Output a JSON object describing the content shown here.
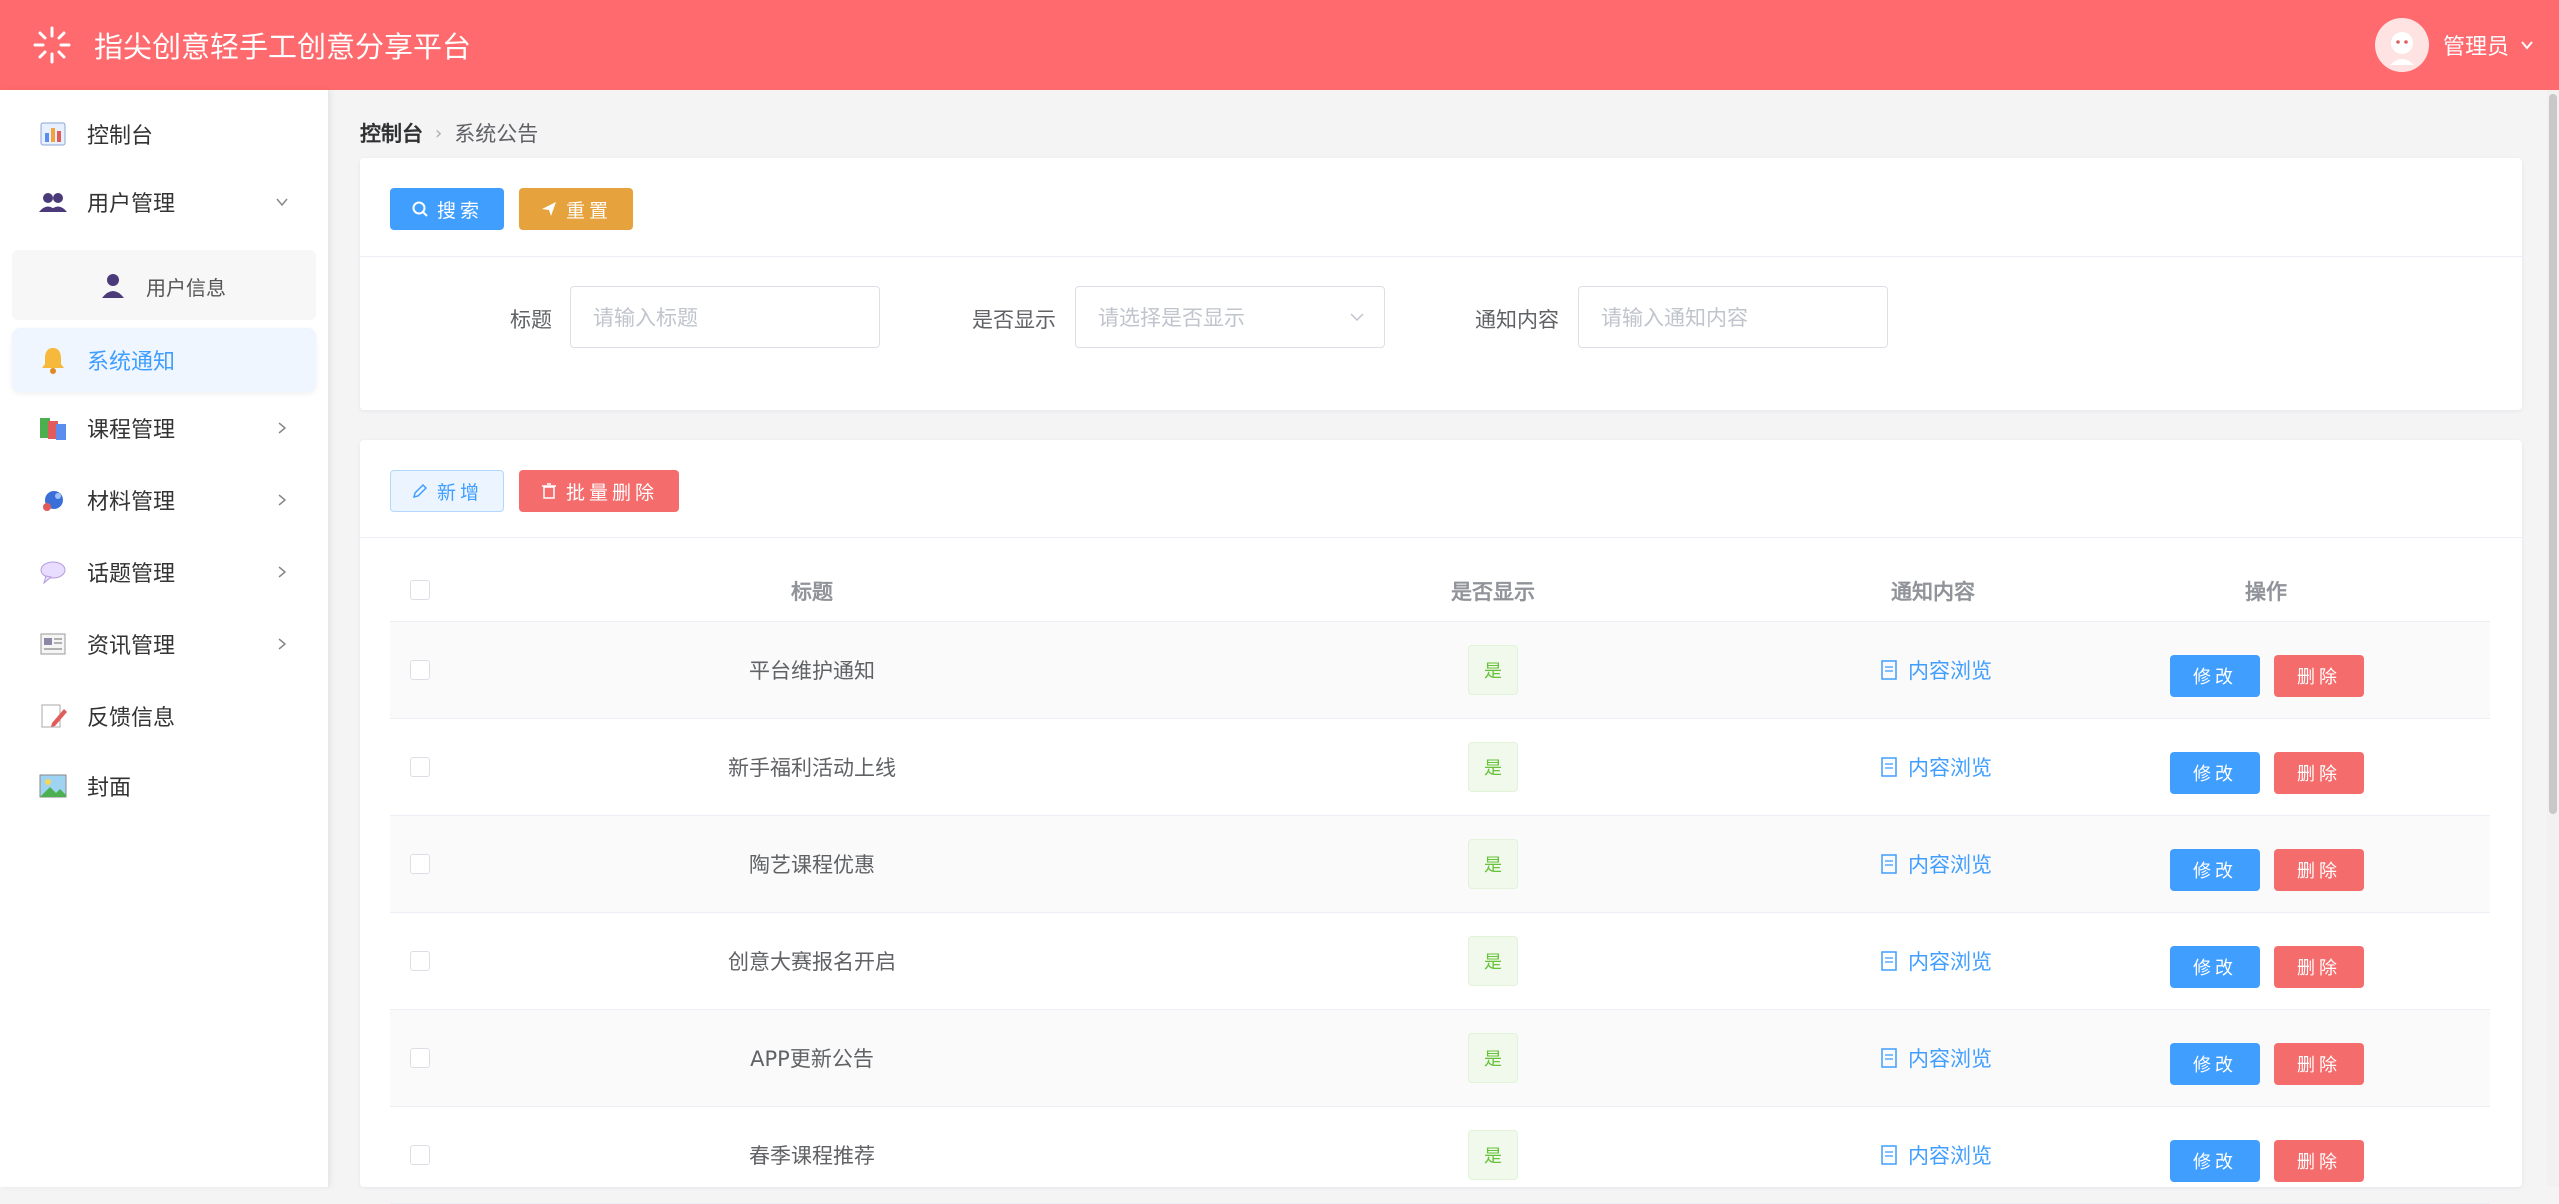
{
  "app": {
    "title": "指尖创意轻手工创意分享平台"
  },
  "user": {
    "name": "管理员"
  },
  "sidebar": {
    "items": [
      {
        "label": "控制台",
        "icon": "dashboard-icon"
      },
      {
        "label": "用户管理",
        "icon": "users-icon"
      },
      {
        "label": "用户信息",
        "icon": "user-icon"
      },
      {
        "label": "系统通知",
        "icon": "bell-icon"
      },
      {
        "label": "课程管理",
        "icon": "books-icon"
      },
      {
        "label": "材料管理",
        "icon": "material-icon"
      },
      {
        "label": "话题管理",
        "icon": "chat-bubble-icon"
      },
      {
        "label": "资讯管理",
        "icon": "news-icon"
      },
      {
        "label": "反馈信息",
        "icon": "feedback-icon"
      },
      {
        "label": "封面",
        "icon": "picture-icon"
      }
    ]
  },
  "breadcrumb": {
    "home": "控制台",
    "current": "系统公告"
  },
  "toolbar": {
    "search": "搜索",
    "reset": "重置",
    "add": "新增",
    "batch_delete": "批量删除"
  },
  "filters": {
    "title_label": "标题",
    "title_placeholder": "请输入标题",
    "show_label": "是否显示",
    "show_placeholder": "请选择是否显示",
    "content_label": "通知内容",
    "content_placeholder": "请输入通知内容"
  },
  "table": {
    "headers": [
      "标题",
      "是否显示",
      "通知内容",
      "操作"
    ],
    "rows": [
      {
        "title": "平台维护通知",
        "show": "是",
        "content": "内容浏览"
      },
      {
        "title": "新手福利活动上线",
        "show": "是",
        "content": "内容浏览"
      },
      {
        "title": "陶艺课程优惠",
        "show": "是",
        "content": "内容浏览"
      },
      {
        "title": "创意大赛报名开启",
        "show": "是",
        "content": "内容浏览"
      },
      {
        "title": "APP更新公告",
        "show": "是",
        "content": "内容浏览"
      },
      {
        "title": "春季课程推荐",
        "show": "是",
        "content": "内容浏览"
      }
    ],
    "edit_label": "修改",
    "delete_label": "删除"
  },
  "colors": {
    "header": "#fe6a6d",
    "primary": "#409eff",
    "warning": "#e6a23c",
    "danger": "#f56c6c",
    "success": "#67c23a"
  }
}
